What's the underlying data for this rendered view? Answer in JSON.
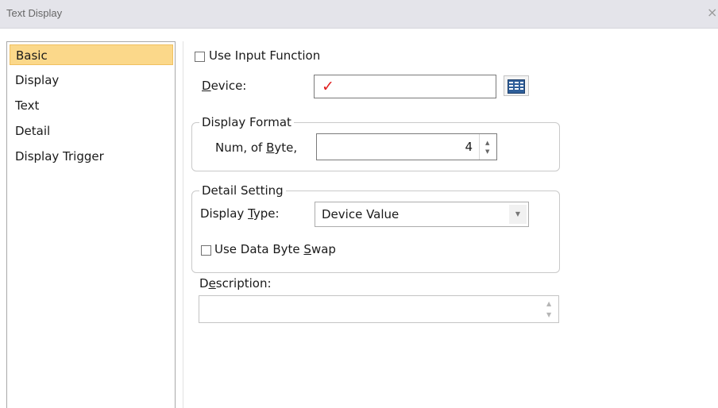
{
  "window": {
    "title": "Text Display",
    "close_glyph": "×"
  },
  "nav": {
    "items": [
      {
        "label": "Basic",
        "active": true
      },
      {
        "label": "Display",
        "active": false
      },
      {
        "label": "Text",
        "active": false
      },
      {
        "label": "Detail",
        "active": false
      },
      {
        "label": "Display Trigger",
        "active": false
      }
    ]
  },
  "basic": {
    "use_input_function": {
      "label": "Use Input Function",
      "checked": false
    },
    "device": {
      "label_prefix": "D",
      "label_rest": "evice:",
      "value": "✓",
      "button_icon": "device-browse-icon"
    },
    "display_format": {
      "title": "Display Format",
      "num_of_byte": {
        "label_pre": "Num, of ",
        "label_u": "B",
        "label_post": "yte,",
        "value": "4"
      }
    },
    "detail_setting": {
      "title": "Detail Setting",
      "display_type": {
        "label_pre": "Display ",
        "label_u": "T",
        "label_post": "ype:",
        "value": "Device Value"
      },
      "byte_swap": {
        "label_pre": "Use Data Byte ",
        "label_u": "S",
        "label_post": "wap",
        "checked": false
      }
    },
    "description": {
      "label_pre": "D",
      "label_u": "e",
      "label_post": "scription:",
      "value": ""
    }
  },
  "colors": {
    "active_nav": "#fbd88a",
    "titlebar": "#e4e4ea",
    "device_mark": "#e02020"
  }
}
